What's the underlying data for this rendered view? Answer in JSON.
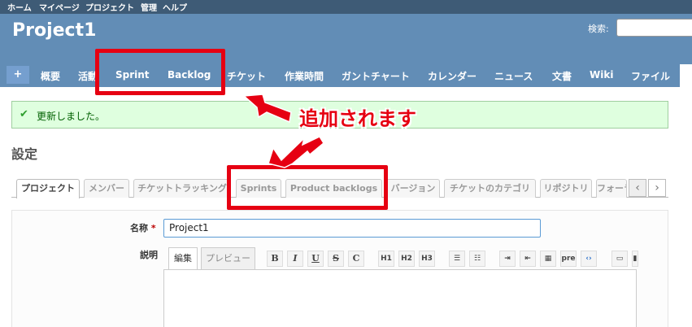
{
  "top_menu": {
    "items": [
      "ホーム",
      "マイページ",
      "プロジェクト",
      "管理",
      "ヘルプ"
    ]
  },
  "header": {
    "project_title": "Project1",
    "search_label": "検索:"
  },
  "main_menu": {
    "plus": "+",
    "tabs": [
      "概要",
      "活動",
      "Sprint",
      "Backlog",
      "チケット",
      "作業時間",
      "ガントチャート",
      "カレンダー",
      "ニュース",
      "文書",
      "Wiki",
      "ファイル"
    ]
  },
  "flash": {
    "message": "更新しました。"
  },
  "page": {
    "heading": "設定"
  },
  "settings_tabs": [
    "プロジェクト",
    "メンバー",
    "チケットトラッキング",
    "Sprints",
    "Product backlogs",
    "バージョン",
    "チケットのカテゴリ",
    "リポジトリ",
    "フォーラム"
  ],
  "form": {
    "name_label": "名称",
    "required_mark": "*",
    "name_value": "Project1",
    "description_label": "説明",
    "edit_tab": "編集",
    "preview_tab": "プレビュー",
    "toolbar": [
      "B",
      "I",
      "U",
      "S",
      "C",
      "H1",
      "H2",
      "H3",
      "ul",
      "ol",
      "indent",
      "outdent",
      "table",
      "pre",
      "code",
      "img"
    ]
  },
  "annotation": {
    "text": "追加されます",
    "color": "#e60012"
  },
  "colors": {
    "top_menu_bg": "#3e5b76",
    "header_bg": "#628db6",
    "flash_bg": "#dfffdf"
  }
}
